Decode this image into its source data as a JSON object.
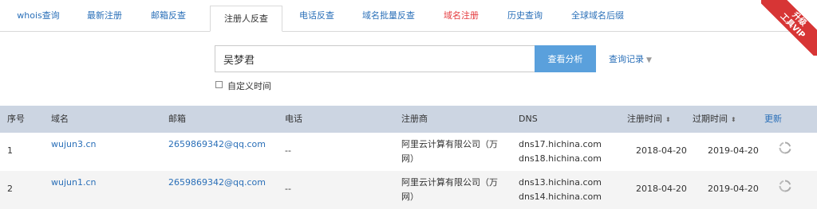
{
  "tabs": [
    {
      "label": "whois查询"
    },
    {
      "label": "最新注册"
    },
    {
      "label": "邮箱反查"
    },
    {
      "label": "注册人反查",
      "active": true
    },
    {
      "label": "电话反查"
    },
    {
      "label": "域名批量反查"
    },
    {
      "label": "域名注册",
      "color": "#e4393c"
    },
    {
      "label": "历史查询"
    },
    {
      "label": "全球域名后缀"
    }
  ],
  "ribbon": {
    "line1": "升级",
    "line2": "工具VIP",
    "color": "#d73535"
  },
  "search": {
    "value": "吴梦君",
    "button_label": "查看分析",
    "history_label": "查询记录",
    "custom_time_label": "自定义时间",
    "custom_time_checked": false
  },
  "table": {
    "columns": {
      "index": "序号",
      "domain": "域名",
      "email": "邮箱",
      "phone": "电话",
      "registrar": "注册商",
      "dns": "DNS",
      "reg_time": "注册时间",
      "exp_time": "过期时间",
      "update": "更新"
    },
    "rows": [
      {
        "index": "1",
        "domain": "wujun3.cn",
        "email": "2659869342@qq.com",
        "phone": "--",
        "registrar_line1": "阿里云计算有限公司（万",
        "registrar_line2": "网）",
        "dns1": "dns17.hichina.com",
        "dns2": "dns18.hichina.com",
        "reg_time": "2018-04-20",
        "exp_time": "2019-04-20"
      },
      {
        "index": "2",
        "domain": "wujun1.cn",
        "email": "2659869342@qq.com",
        "phone": "--",
        "registrar_line1": "阿里云计算有限公司（万",
        "registrar_line2": "网）",
        "dns1": "dns13.hichina.com",
        "dns2": "dns14.hichina.com",
        "reg_time": "2018-04-20",
        "exp_time": "2019-04-20"
      }
    ]
  },
  "colors": {
    "link": "#2a6fb8",
    "accent_button": "#5aa0dc",
    "table_header": "#ccd5e2"
  }
}
